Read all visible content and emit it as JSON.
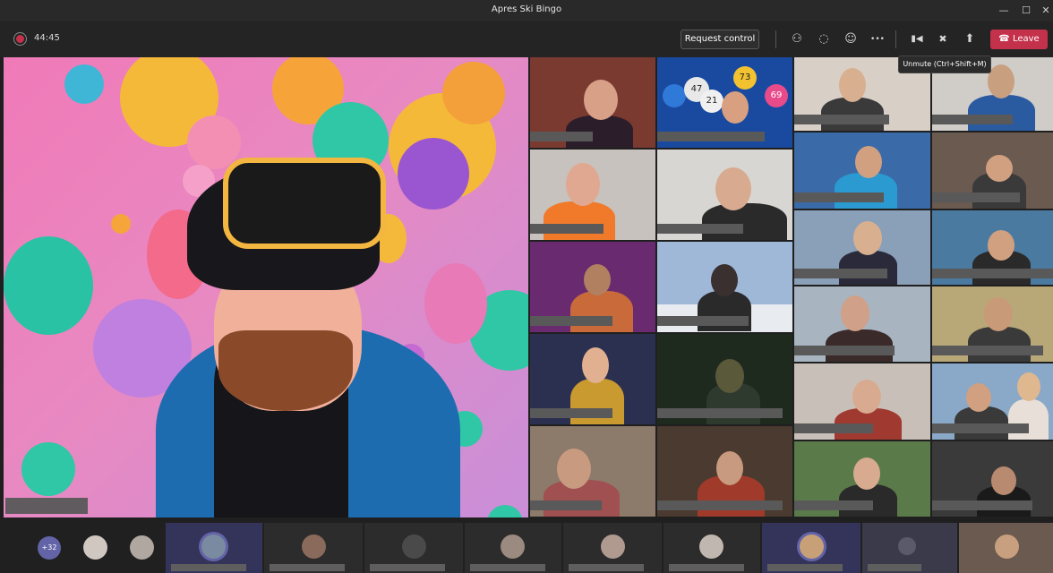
{
  "window": {
    "title": "Apres Ski Bingo"
  },
  "window_controls": {
    "minimize": "—",
    "maximize": "☐",
    "close": "✕"
  },
  "toolbar": {
    "timer": "44:45",
    "request_control_label": "Request control",
    "leave_label": "Leave",
    "icons": {
      "people": "⚇",
      "chat": "◌",
      "reactions": "☺",
      "more": "•••",
      "camera": "▮◀",
      "mic": "✖",
      "share": "⬆",
      "phone": "☎"
    }
  },
  "tooltip": {
    "mic": "Unmute (Ctrl+Shift+M)"
  },
  "stage": {
    "bingo_balls": [
      "47",
      "73",
      "21",
      "69"
    ]
  },
  "strip": {
    "overflow_count": "+32"
  },
  "colors": {
    "leave": "#c4314b",
    "accent": "#6264a7",
    "recording": "#c4314b"
  }
}
